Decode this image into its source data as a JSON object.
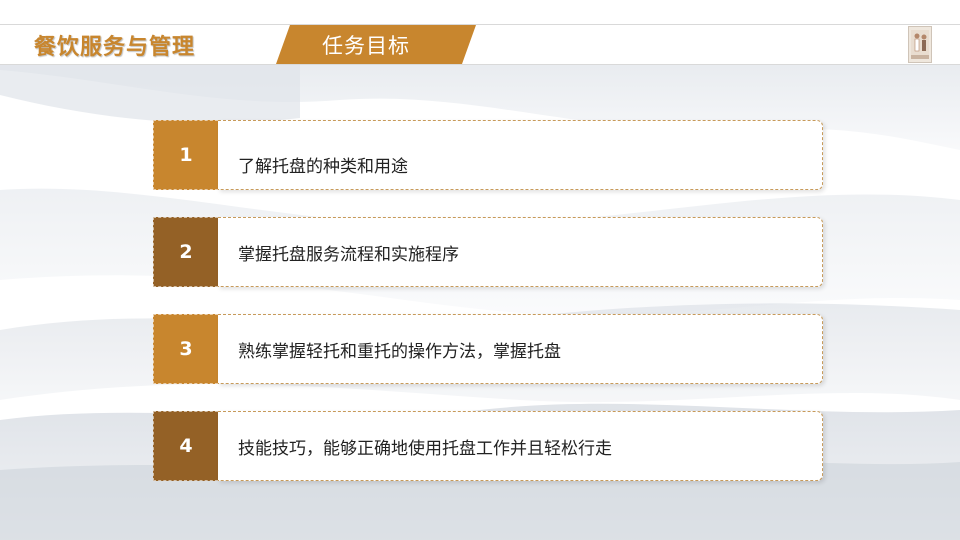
{
  "header": {
    "course_title": "餐饮服务与管理",
    "section_title": "任务目标"
  },
  "goals": [
    {
      "number": "1",
      "text": "了解托盘的种类和用途",
      "color": "#c8862e"
    },
    {
      "number": "2",
      "text": "掌握托盘服务流程和实施程序",
      "color": "#946126"
    },
    {
      "number": "3",
      "text": "熟练掌握轻托和重托的操作方法，掌握托盘",
      "color": "#c8862e"
    },
    {
      "number": "4",
      "text": "技能技巧，能够正确地使用托盘工作并且轻松行走",
      "color": "#946126"
    }
  ],
  "colors": {
    "accent": "#c8862e",
    "accent_dark": "#946126"
  }
}
